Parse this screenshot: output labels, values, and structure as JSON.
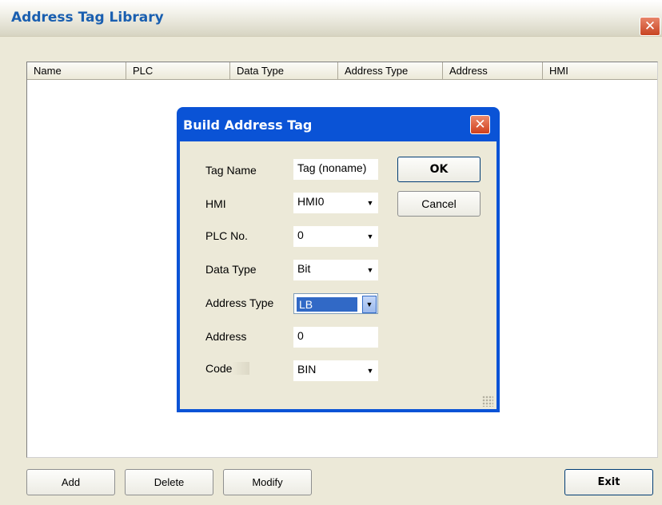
{
  "window": {
    "title": "Address Tag Library",
    "close_glyph": "✕"
  },
  "list": {
    "columns": [
      "Name",
      "PLC",
      "Data Type",
      "Address Type",
      "Address",
      "HMI"
    ]
  },
  "buttons": {
    "add": "Add",
    "delete": "Delete",
    "modify": "Modify",
    "exit": "Exit"
  },
  "dialog": {
    "title": "Build Address Tag",
    "close_glyph": "✕",
    "ok": "OK",
    "cancel": "Cancel",
    "labels": {
      "tag_name": "Tag Name",
      "hmi": "HMI",
      "plc_no": "PLC No.",
      "data_type": "Data Type",
      "address_type": "Address Type",
      "address": "Address",
      "code": "Code"
    },
    "values": {
      "tag_name": "Tag (noname)",
      "hmi": "HMI0",
      "plc_no": "0",
      "data_type": "Bit",
      "address_type": "LB",
      "address": "0",
      "code": "BIN"
    },
    "dropdown_glyph": "▼"
  },
  "colors": {
    "title_blue": "#1a5fb0",
    "dialog_frame": "#0a53d6",
    "selection": "#3169c6",
    "close_red": "#c84422"
  }
}
